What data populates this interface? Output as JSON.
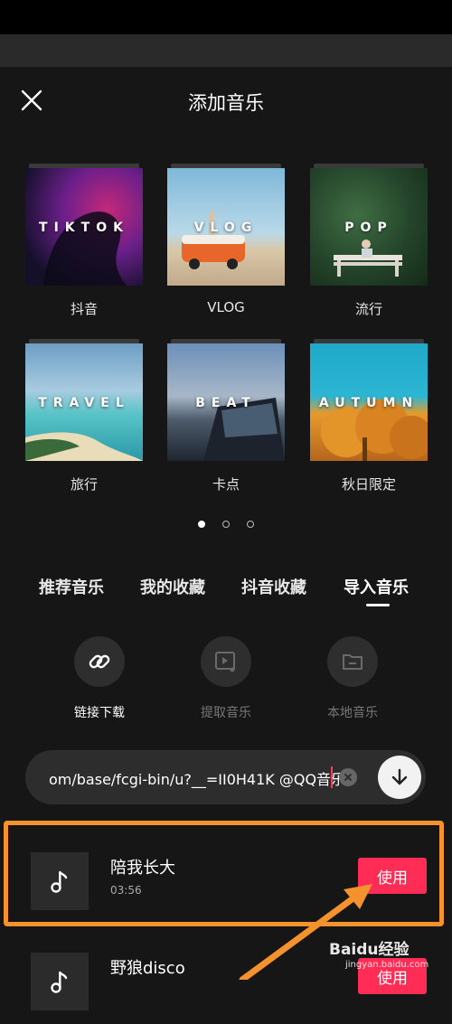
{
  "header": {
    "title": "添加音乐"
  },
  "categories": [
    {
      "thumb_text": "TIKTOK",
      "caption": "抖音"
    },
    {
      "thumb_text": "VLOG",
      "caption": "VLOG"
    },
    {
      "thumb_text": "POP",
      "caption": "流行"
    },
    {
      "thumb_text": "TRAVEL",
      "caption": "旅行"
    },
    {
      "thumb_text": "BEAT",
      "caption": "卡点"
    },
    {
      "thumb_text": "AUTUMN",
      "caption": "秋日限定"
    }
  ],
  "pager": {
    "current_page": 1,
    "total_pages": 3
  },
  "tabs": [
    {
      "label": "推荐音乐"
    },
    {
      "label": "我的收藏"
    },
    {
      "label": "抖音收藏"
    },
    {
      "label": "导入音乐"
    }
  ],
  "active_tab": "导入音乐",
  "actions": [
    {
      "label": "链接下载",
      "icon": "link-icon",
      "enabled": true
    },
    {
      "label": "提取音乐",
      "icon": "video-music-icon",
      "enabled": false
    },
    {
      "label": "本地音乐",
      "icon": "folder-icon",
      "enabled": false
    }
  ],
  "url_input": {
    "value": "om/base/fcgi-bin/u?__=II0H41K @QQ音乐"
  },
  "songs": [
    {
      "name": "陪我长大",
      "duration": "03:56",
      "use_label": "使用",
      "icon": "music-note-icon"
    },
    {
      "name": "野狼disco",
      "duration": "",
      "use_label": "使用",
      "icon": "music-note-icon"
    }
  ],
  "watermark": {
    "brand": "Baidu经验",
    "url": "jingyan.baidu.com"
  },
  "colors": {
    "accent": "#ff2c55",
    "highlight": "#f5922e",
    "background": "#161616"
  }
}
